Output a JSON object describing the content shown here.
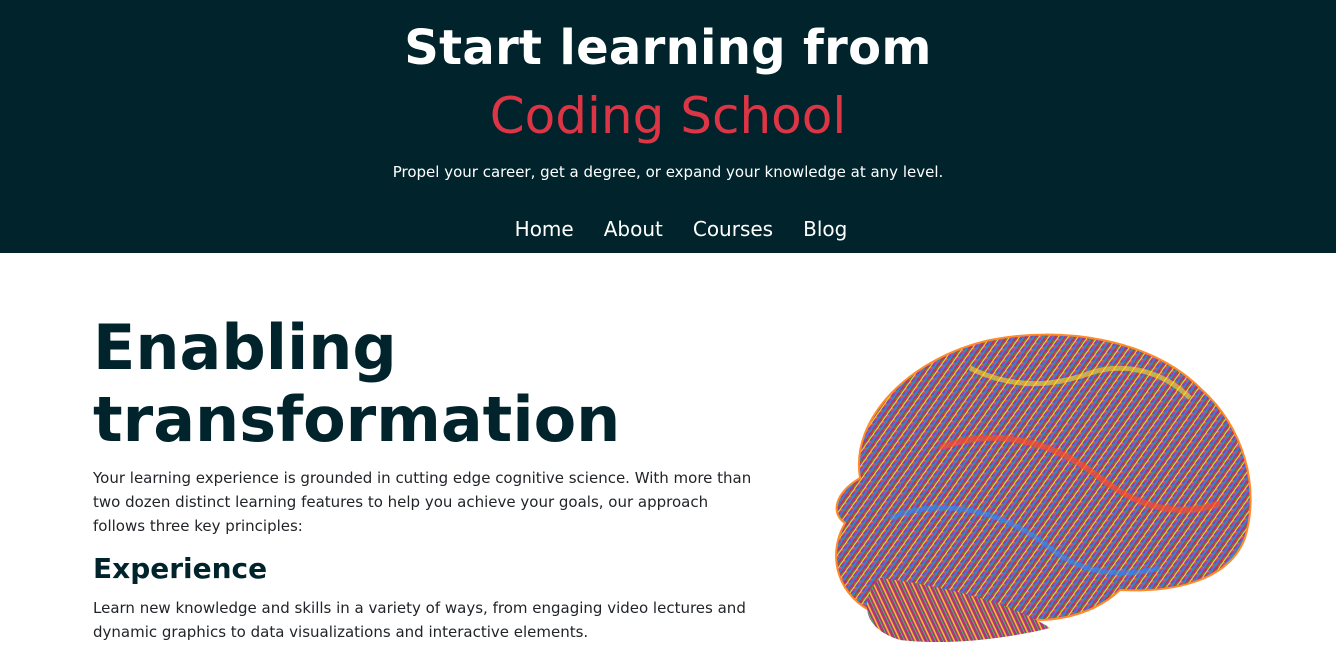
{
  "hero": {
    "title": "Start learning from",
    "brand": "Coding School",
    "tagline": "Propel your career, get a degree, or expand your knowledge at any level.",
    "background_color": "#01242c",
    "brand_color": "#dc3545"
  },
  "nav": {
    "items": [
      {
        "label": "Home"
      },
      {
        "label": "About"
      },
      {
        "label": "Courses"
      },
      {
        "label": "Blog"
      }
    ]
  },
  "main": {
    "heading": "Enabling transformation",
    "intro": "Your learning experience is grounded in cutting edge cognitive science. With more than two dozen distinct learning features to help you achieve your goals, our approach follows three key principles:",
    "sections": [
      {
        "title": "Experience",
        "body": "Learn new knowledge and skills in a variety of ways, from engaging video lectures and dynamic graphics to data visualizations and interactive elements."
      }
    ]
  },
  "illustration": {
    "icon": "colorful-brain-fibers-image"
  }
}
